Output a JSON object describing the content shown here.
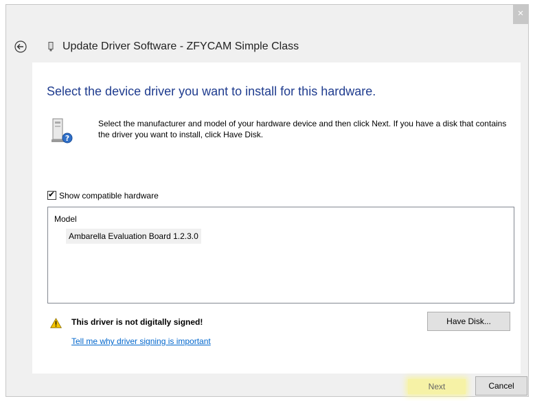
{
  "window": {
    "close_label": "×",
    "title": "Update Driver Software - ZFYCAM Simple Class"
  },
  "content": {
    "heading": "Select the device driver you want to install for this hardware.",
    "description": "Select the manufacturer and model of your hardware device and then click Next. If you have a disk that contains the driver you want to install, click Have Disk.",
    "show_compatible_label": "Show compatible hardware",
    "show_compatible_checked": true,
    "model_list": {
      "header": "Model",
      "items": [
        "Ambarella Evaluation Board 1.2.3.0"
      ]
    },
    "warning": {
      "text": "This driver is not digitally signed!",
      "link": "Tell me why driver signing is important"
    },
    "have_disk_label": "Have Disk..."
  },
  "footer": {
    "next_label": "Next",
    "cancel_label": "Cancel"
  },
  "colors": {
    "heading": "#1e3b8e",
    "link": "#0066cc",
    "next_highlight": "#f6f2a6",
    "warning": "#f5c400"
  },
  "icons": {
    "back": "back-arrow-icon",
    "title": "usb-device-icon",
    "hardware": "hardware-question-icon",
    "warning": "warning-triangle-icon",
    "checkbox": "checkmark-icon"
  }
}
